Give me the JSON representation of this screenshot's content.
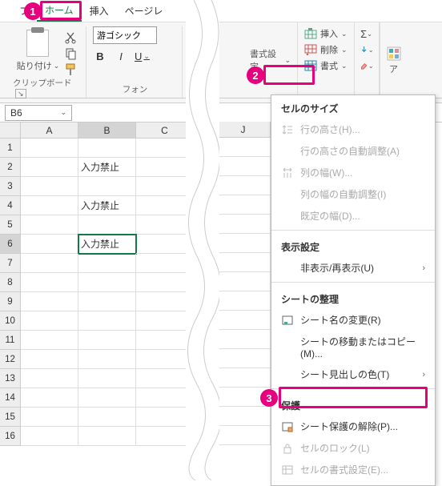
{
  "tabs": {
    "file_prefix": "フ",
    "home": "ホーム",
    "insert": "挿入",
    "page_layout_prefix": "ページレ"
  },
  "ribbon": {
    "paste_label": "貼り付け",
    "clipboard_label": "クリップボード",
    "font_select": "游ゴシック",
    "font_label_prefix": "フォン",
    "bold": "B",
    "italic": "I",
    "underline": "U",
    "format_setting_suffix": "書式設定",
    "cells": {
      "insert": "挿入",
      "delete": "削除",
      "format": "書式"
    },
    "right_label_prefix": "ア"
  },
  "namebox": "B6",
  "columns": [
    "A",
    "B",
    "C",
    "J"
  ],
  "rows": [
    "1",
    "2",
    "3",
    "4",
    "5",
    "6",
    "7",
    "8",
    "9",
    "10",
    "11",
    "12",
    "13",
    "14",
    "15",
    "16"
  ],
  "cell_b2": "入力禁止",
  "cell_b4": "入力禁止",
  "cell_b6": "入力禁止",
  "dropdown": {
    "section_cell_size": "セルのサイズ",
    "row_height": "行の高さ(H)...",
    "auto_row_height": "行の高さの自動調整(A)",
    "col_width": "列の幅(W)...",
    "auto_col_width": "列の幅の自動調整(I)",
    "default_width": "既定の幅(D)...",
    "section_display": "表示設定",
    "hide_unhide": "非表示/再表示(U)",
    "section_sheet": "シートの整理",
    "rename_sheet": "シート名の変更(R)",
    "move_copy_sheet": "シートの移動またはコピー(M)...",
    "tab_color": "シート見出しの色(T)",
    "section_protect": "保護",
    "unprotect_sheet": "シート保護の解除(P)...",
    "lock_cell": "セルのロック(L)",
    "format_cells": "セルの書式設定(E)..."
  },
  "badges": {
    "one": "1",
    "two": "2",
    "three": "3"
  }
}
